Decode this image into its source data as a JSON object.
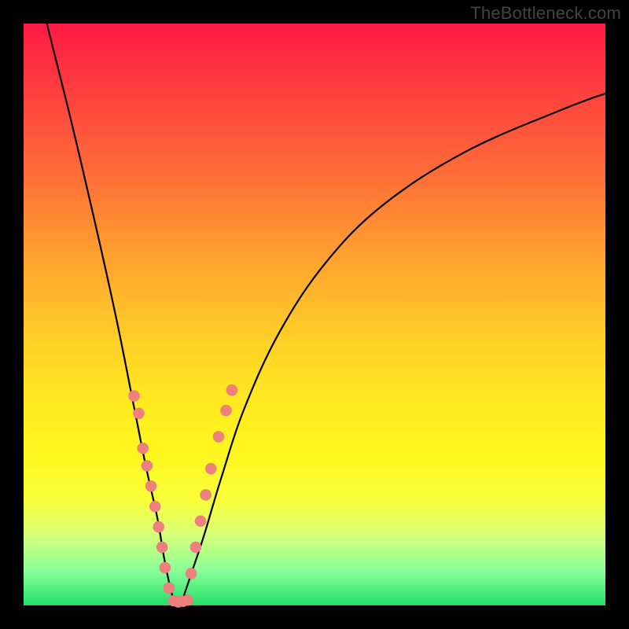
{
  "watermark": "TheBottleneck.com",
  "colors": {
    "frame": "#000000",
    "curve": "#000000",
    "dots": "#f08080",
    "gradient_top": "#ff1a44",
    "gradient_bottom": "#22e06a"
  },
  "chart_data": {
    "type": "line",
    "title": "",
    "xlabel": "",
    "ylabel": "",
    "xlim": [
      0,
      100
    ],
    "ylim": [
      0,
      100
    ],
    "notes": "V-shaped bottleneck curve on red-to-green gradient; minimum near x≈26. Two black curved arms descend to the green floor; coral dots cluster along lower arms.",
    "series": [
      {
        "name": "left-arm",
        "x": [
          4,
          8,
          12,
          16,
          19,
          21,
          23,
          24,
          25,
          26
        ],
        "y": [
          100,
          84,
          67,
          49,
          34,
          24,
          15,
          9,
          4,
          0
        ]
      },
      {
        "name": "right-arm",
        "x": [
          27,
          28,
          29,
          31,
          34,
          38,
          44,
          52,
          62,
          76,
          92,
          100
        ],
        "y": [
          0,
          3,
          6,
          12,
          22,
          34,
          47,
          59,
          69,
          78,
          85,
          88
        ]
      }
    ],
    "scatter": {
      "name": "dots",
      "points": [
        {
          "x": 19.0,
          "y": 36.0
        },
        {
          "x": 19.8,
          "y": 33.0
        },
        {
          "x": 20.5,
          "y": 27.0
        },
        {
          "x": 21.2,
          "y": 24.0
        },
        {
          "x": 21.9,
          "y": 20.5
        },
        {
          "x": 22.6,
          "y": 17.0
        },
        {
          "x": 23.2,
          "y": 13.5
        },
        {
          "x": 23.8,
          "y": 10.0
        },
        {
          "x": 24.3,
          "y": 6.5
        },
        {
          "x": 25.0,
          "y": 3.0
        },
        {
          "x": 25.8,
          "y": 0.8
        },
        {
          "x": 26.6,
          "y": 0.6
        },
        {
          "x": 27.4,
          "y": 0.7
        },
        {
          "x": 28.2,
          "y": 0.9
        },
        {
          "x": 28.8,
          "y": 5.5
        },
        {
          "x": 29.6,
          "y": 10.0
        },
        {
          "x": 30.4,
          "y": 14.5
        },
        {
          "x": 31.3,
          "y": 19.0
        },
        {
          "x": 32.2,
          "y": 23.5
        },
        {
          "x": 33.5,
          "y": 29.0
        },
        {
          "x": 34.8,
          "y": 33.5
        },
        {
          "x": 35.8,
          "y": 37.0
        }
      ]
    }
  }
}
